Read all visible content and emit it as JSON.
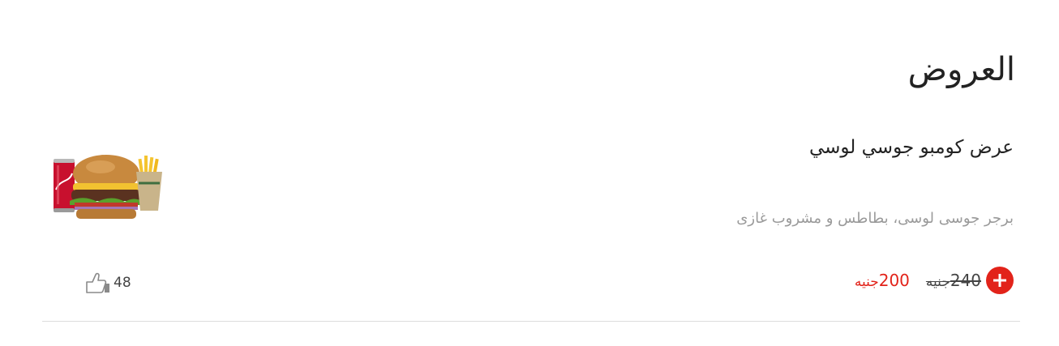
{
  "section": {
    "title": "العروض"
  },
  "item": {
    "name": "عرض كومبو جوسي لوسي",
    "description": "برجر جوسى لوسى، بطاطس و مشروب غازى",
    "old_price": "240",
    "new_price": "200",
    "currency": "جنيه",
    "likes": "48",
    "image_icon": "combo-meal-image",
    "add_icon": "plus-icon",
    "like_icon": "thumbs-up-icon"
  },
  "colors": {
    "accent": "#e2231a",
    "text": "#222222",
    "muted": "#9a9a9a",
    "divider": "#dddddd"
  }
}
